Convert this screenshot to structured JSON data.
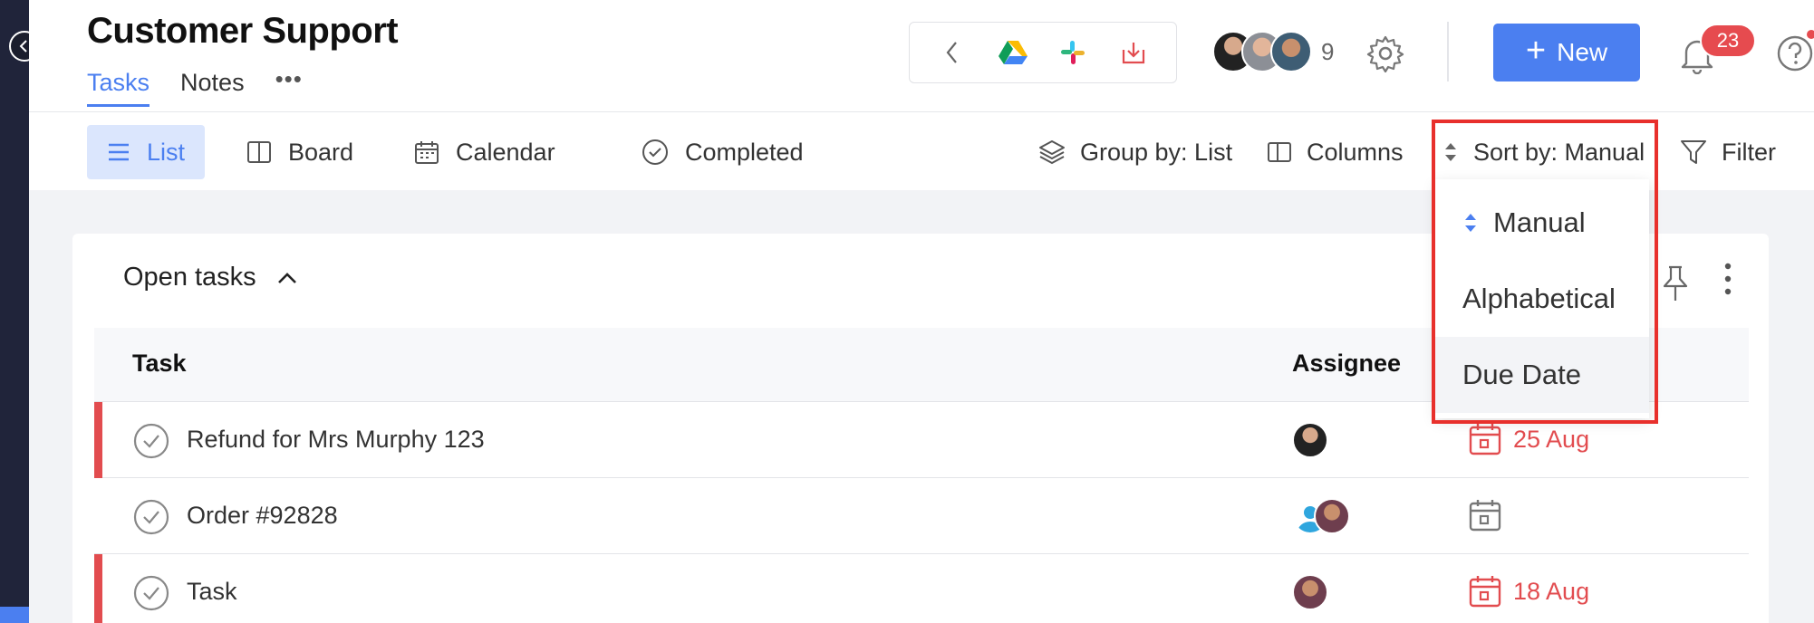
{
  "header": {
    "title": "Customer Support",
    "tabs": [
      {
        "label": "Tasks",
        "active": true
      },
      {
        "label": "Notes",
        "active": false
      }
    ],
    "more_label": "•••",
    "members_count": "9",
    "new_button": {
      "icon": "+",
      "label": "New"
    },
    "notifications_count": "23"
  },
  "toolbar": {
    "views": [
      {
        "label": "List",
        "icon": "list-icon",
        "active": true
      },
      {
        "label": "Board",
        "icon": "board-icon"
      },
      {
        "label": "Calendar",
        "icon": "calendar-icon"
      },
      {
        "label": "Completed",
        "icon": "check-circle-icon"
      }
    ],
    "group_by": "Group by: List",
    "columns": "Columns",
    "sort_by": "Sort by: Manual",
    "filter": "Filter"
  },
  "sort_dropdown": {
    "options": [
      {
        "label": "Manual",
        "selected": true
      },
      {
        "label": "Alphabetical"
      },
      {
        "label": "Due Date",
        "hovered": true
      }
    ]
  },
  "section": {
    "title": "Open tasks",
    "columns": {
      "task": "Task",
      "assignee": "Assignee"
    },
    "rows": [
      {
        "name": "Refund for Mrs Murphy 123",
        "due": "25 Aug",
        "priority": true
      },
      {
        "name": "Order #92828",
        "due": "",
        "priority": false
      },
      {
        "name": "Task",
        "due": "18 Aug",
        "priority": true
      }
    ]
  },
  "colors": {
    "accent": "#4b7ff0",
    "danger": "#e24c4f",
    "highlight": "#e8302c",
    "sidebar": "#20243a"
  }
}
